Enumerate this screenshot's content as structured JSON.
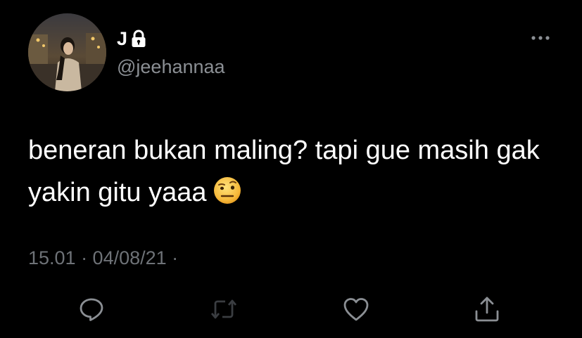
{
  "tweet": {
    "display_name": "J",
    "handle": "@jeehannaa",
    "text": "beneran bukan maling? tapi gue masih gak yakin gitu yaaa",
    "emoji": "face-with-raised-eyebrow-emoji",
    "timestamp": "15.01 · 04/08/21 ·",
    "protected_account": true
  },
  "icons": {
    "lock": "lock-icon",
    "more": "more-options-icon",
    "reply": "reply-icon",
    "retweet": "retweet-icon",
    "like": "like-icon",
    "share": "share-icon"
  },
  "colors": {
    "background": "#000000",
    "text": "#ffffff",
    "secondary_text": "#8b8f94",
    "icon": "#8b8f94",
    "retweet_disabled": "#3a3d41"
  }
}
